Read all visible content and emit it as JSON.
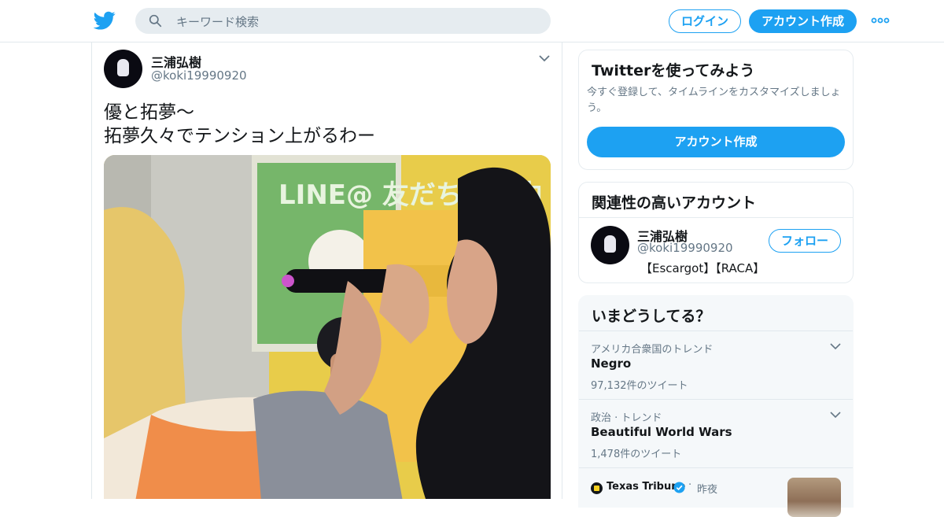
{
  "header": {
    "search_placeholder": "キーワード検索",
    "login_label": "ログイン",
    "signup_label": "アカウント作成"
  },
  "tweet": {
    "author_name": "三浦弘樹",
    "author_handle": "@koki19990920",
    "text_lines": [
      "優と拓夢～",
      "拓夢久々でテンション上がるわー"
    ],
    "photo_sign_text": "LINE@ 友だち募集中"
  },
  "sidebar": {
    "signup_card": {
      "title": "Twitterを使ってみよう",
      "description": "今すぐ登録して、タイムラインをカスタマイズしましょう。",
      "button_label": "アカウント作成"
    },
    "related": {
      "title": "関連性の高いアカウント",
      "account": {
        "name": "三浦弘樹",
        "handle": "@koki19990920",
        "bio": "【Escargot】【RACA】",
        "follow_label": "フォロー"
      }
    },
    "trends": {
      "title": "いまどうしてる？",
      "items": [
        {
          "context": "アメリカ合衆国のトレンド",
          "name": "Negro",
          "count": "97,132件のツイート"
        },
        {
          "context": "政治 · トレンド",
          "name": "Beautiful World Wars",
          "count": "1,478件のツイート"
        }
      ],
      "news": {
        "source": "Texas Tribune",
        "dot": "·",
        "time": "昨夜"
      }
    }
  },
  "colors": {
    "accent": "#1da1f2",
    "text": "#14171a",
    "muted": "#657786"
  }
}
